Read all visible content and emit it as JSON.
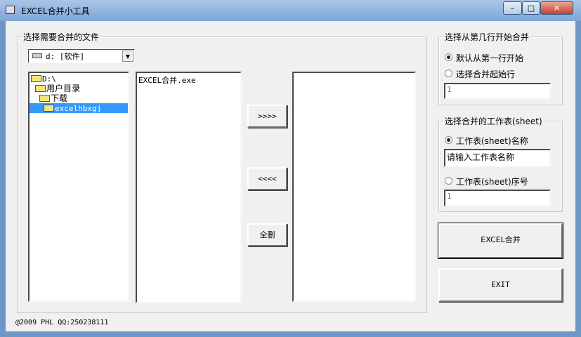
{
  "window": {
    "title": "EXCEL合并小工具",
    "minimize": "–",
    "maximize": "□",
    "close": "✕"
  },
  "files_group": {
    "legend": "选择需要合并的文件",
    "drive": "d: [软件]",
    "tree": [
      "D:\\",
      "用户目录",
      "下载",
      "excelhbxgj"
    ],
    "file_list": [
      "EXCEL合并.exe"
    ],
    "selected_list": [],
    "add_button": ">>>>",
    "remove_button": "<<<<",
    "clear_button": "全删"
  },
  "row_group": {
    "legend": "选择从第几行开始合并",
    "option_default": "默认从第一行开始",
    "option_custom": "选择合并起始行",
    "start_row": "1",
    "selected": "default"
  },
  "sheet_group": {
    "legend": "选择合并的工作表(sheet)",
    "option_name": "工作表(sheet)名称",
    "name_value": "请输入工作表名称",
    "option_index": "工作表(sheet)序号",
    "index_value": "1",
    "selected": "name"
  },
  "merge_button": "EXCEL合并",
  "exit_button": "EXIT",
  "status": "@2009 PHL QQ:250238111"
}
